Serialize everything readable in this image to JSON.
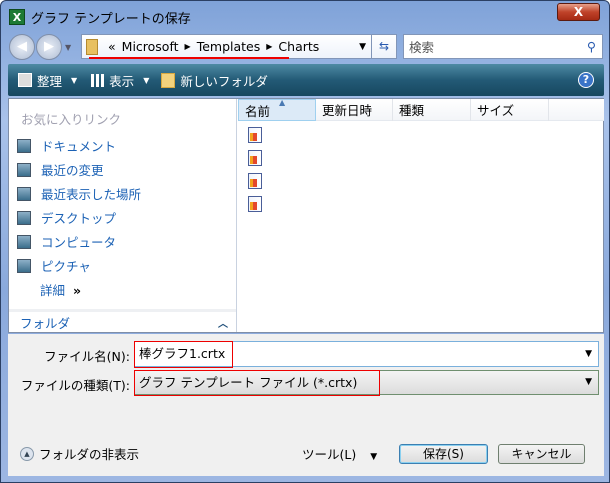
{
  "window": {
    "title": "グラフ テンプレートの保存",
    "close": "X"
  },
  "address": {
    "prefix": "«",
    "crumbs": [
      "Microsoft",
      "Templates",
      "Charts"
    ]
  },
  "search": {
    "placeholder": "検索"
  },
  "toolbar": {
    "organize": "整理",
    "views": "表示",
    "new_folder": "新しいフォルダ",
    "help": "?"
  },
  "sidebar": {
    "favorites_header": "お気に入りリンク",
    "links": [
      "ドキュメント",
      "最近の変更",
      "最近表示した場所",
      "デスクトップ",
      "コンピュータ",
      "ピクチャ"
    ],
    "more": "詳細",
    "more_glyph": "»",
    "folders": "フォルダ"
  },
  "list": {
    "columns": [
      "名前",
      "更新日時",
      "種類",
      "サイズ"
    ],
    "file_count": 4
  },
  "form": {
    "filename_label": "ファイル名(N):",
    "filename_value": "棒グラフ1.crtx",
    "filetype_label": "ファイルの種類(T):",
    "filetype_value": "グラフ テンプレート ファイル (*.crtx)"
  },
  "footer": {
    "hide_folders": "フォルダの非表示",
    "tools": "ツール(L)",
    "save": "保存(S)",
    "cancel": "キャンセル"
  },
  "colors": {
    "highlight": "#ee0000",
    "link": "#1c62b5"
  }
}
